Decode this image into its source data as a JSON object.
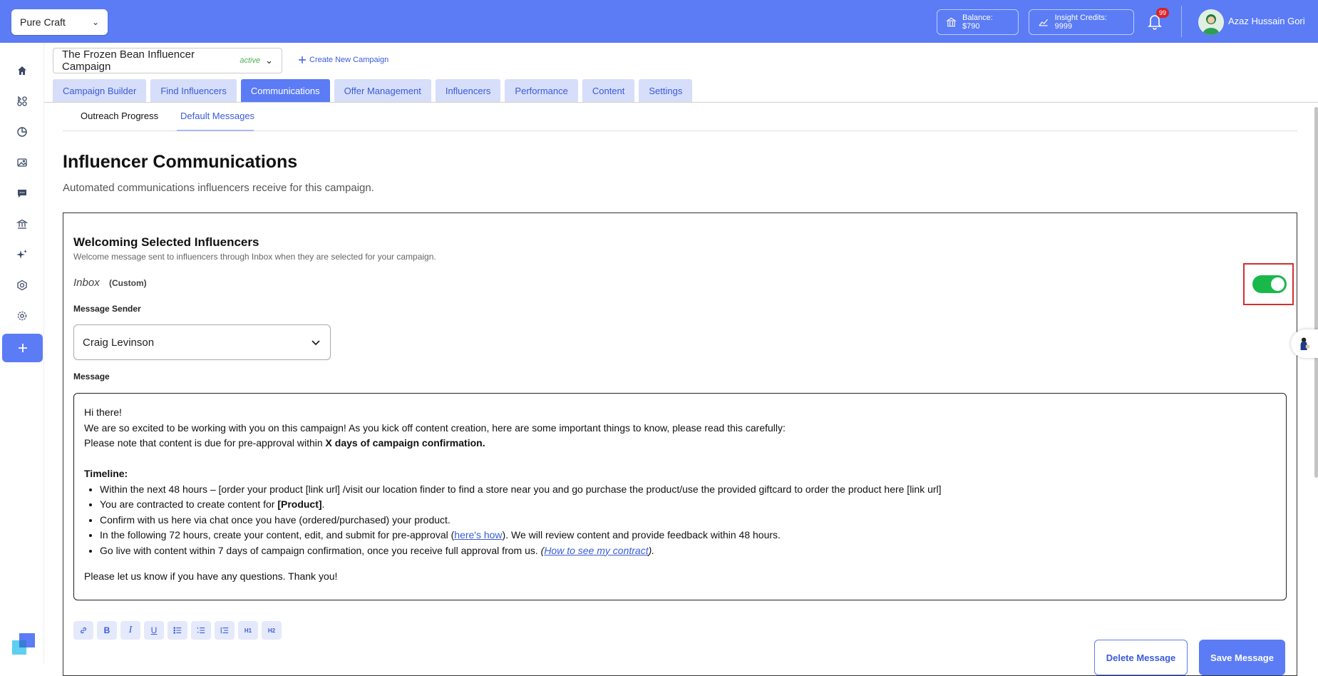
{
  "topbar": {
    "org_name": "Pure Craft",
    "balance": "Balance: $790",
    "insight_credits": "Insight Credits: 9999",
    "notification_count": "99",
    "user_name": "Azaz Hussain Gori"
  },
  "sidebar": {
    "icons": [
      "home-icon",
      "apps-icon",
      "analytics-icon",
      "image-icon",
      "chat-icon",
      "bank-icon",
      "sparkle-icon",
      "target-icon",
      "settings-icon"
    ],
    "add_icon": "plus-icon"
  },
  "campaign": {
    "name": "The Frozen Bean Influencer Campaign",
    "status": "active",
    "create_new": "Create New Campaign"
  },
  "tabs": [
    {
      "label": "Campaign Builder",
      "active": false
    },
    {
      "label": "Find Influencers",
      "active": false
    },
    {
      "label": "Communications",
      "active": true
    },
    {
      "label": "Offer Management",
      "active": false
    },
    {
      "label": "Influencers",
      "active": false
    },
    {
      "label": "Performance",
      "active": false
    },
    {
      "label": "Content",
      "active": false
    },
    {
      "label": "Settings",
      "active": false
    }
  ],
  "subtabs": {
    "outreach": "Outreach Progress",
    "default_messages": "Default Messages"
  },
  "page": {
    "title": "Influencer Communications",
    "subtitle": "Automated communications influencers receive for this campaign."
  },
  "card": {
    "title": "Welcoming Selected Influencers",
    "description": "Welcome message sent to influencers through Inbox when they are selected for your campaign.",
    "channel": "Inbox",
    "channel_type": "(Custom)",
    "enabled": true,
    "sender_label": "Message Sender",
    "sender_value": "Craig Levinson",
    "message_label": "Message"
  },
  "message": {
    "greeting": "Hi there!",
    "intro": "We are so excited to be working with you on this campaign! As you kick off content creation, here are some important things to know, please read this carefully:",
    "note_prefix": "Please note that content is due for pre-approval within ",
    "note_bold": "X days of campaign confirmation.",
    "timeline_heading": "Timeline:",
    "item1": "Within the next 48 hours – [order your product [link url] /visit our location finder to find a store near you and go purchase the product/use the provided giftcard to order the product here [link url]",
    "item2_prefix": "You are contracted to create content for ",
    "item2_bold": "[Product]",
    "item2_suffix": ".",
    "item3": "Confirm with us here via chat once you have (ordered/purchased) your product.",
    "item4_prefix": "In the following 72 hours, create your content, edit, and submit for pre-approval (",
    "item4_link": "here's how",
    "item4_suffix": "). We will review content and provide feedback within 48 hours.",
    "item5_prefix": "Go live with content within 7 days of campaign confirmation, once you receive full approval from us. ",
    "item5_open": "(",
    "item5_link": "How to see my contract",
    "item5_close": ").",
    "closing": "Please let us know if you have any questions. Thank you!"
  },
  "toolbar": {
    "bold": "B",
    "italic": "I",
    "underline": "U",
    "h1": "H1",
    "h2": "H2"
  },
  "actions": {
    "delete": "Delete Message",
    "save": "Save Message"
  },
  "colors": {
    "brand": "#5b7cf5",
    "toggle_on": "#19b84b",
    "highlight": "#d32f2f"
  }
}
